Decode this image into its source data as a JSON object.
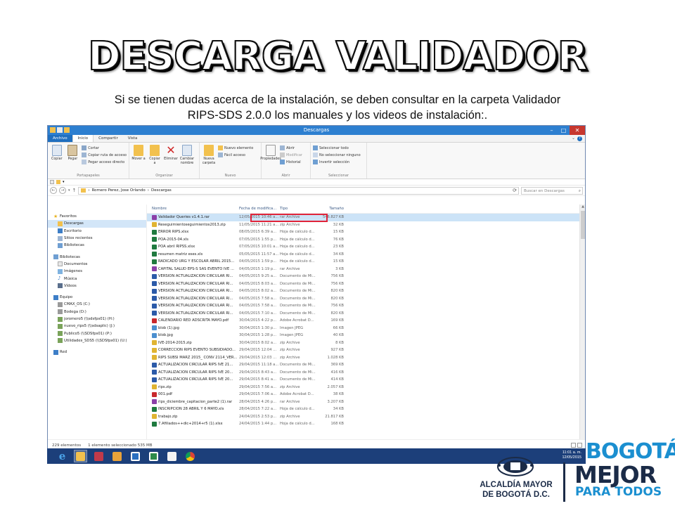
{
  "slide": {
    "title": "DESCARGA VALIDADOR",
    "subtitle_line1": "Si se tienen dudas acerca de la instalación, se deben consultar en  la carpeta Validador",
    "subtitle_line2": "RIPS-SDS 2.0.0 los manuales y los videos de instalación:."
  },
  "window": {
    "title": "Descargas",
    "tabs": [
      "Archivo",
      "Inicio",
      "Compartir",
      "Vista"
    ],
    "ribbon": {
      "portapapeles": {
        "label": "Portapapeles",
        "copiar": "Copiar",
        "pegar": "Pegar",
        "cortar": "Cortar",
        "copiar_ruta": "Copiar ruta de acceso",
        "pegar_acceso": "Pegar acceso directo"
      },
      "organizar": {
        "label": "Organizar",
        "mover": "Mover a",
        "copiar_a": "Copiar a",
        "eliminar": "Eliminar",
        "cambiar_nombre": "Cambiar nombre"
      },
      "nuevo": {
        "label": "Nuevo",
        "nueva_carpeta": "Nueva carpeta",
        "nuevo_elemento": "Nuevo elemento",
        "facil_acceso": "Fácil acceso"
      },
      "abrir": {
        "label": "Abrir",
        "propiedades": "Propiedades",
        "abrir": "Abrir",
        "modificar": "Modificar",
        "historial": "Historial"
      },
      "seleccionar": {
        "label": "Seleccionar",
        "todo": "Seleccionar todo",
        "ninguno": "No seleccionar ninguno",
        "invertir": "Invertir selección"
      }
    },
    "address": {
      "crumb1": "Romero Perez, Jose Orlando",
      "crumb2": "Descargas",
      "search_placeholder": "Buscar en Descargas"
    },
    "nav": {
      "favoritos": "Favoritos",
      "fav_items": [
        "Descargas",
        "Escritorio",
        "Sitios recientes",
        "Bibliotecas"
      ],
      "bibliotecas": "Bibliotecas",
      "lib_items": [
        "Documentos",
        "Imágenes",
        "Música",
        "Vídeos"
      ],
      "equipo": "Equipo",
      "equipo_items": [
        "CMAX_OS (C:)",
        "Bodega (D:)",
        "joromero5 (\\\\sdsfps01) (H:)",
        "nuevo_rips5 (\\\\sdsaplic) (J:)",
        "Publico5 (\\\\SDSfps01) (P:)",
        "Utilidades_SDS5 (\\\\SDSfps01) (U:)"
      ],
      "red": "Red"
    },
    "columns": {
      "name": "Nombre",
      "date": "Fecha de modifica...",
      "type": "Tipo",
      "size": "Tamaño"
    },
    "files": [
      {
        "name": "Validador Queries v1.4.1.rar",
        "date": "12/05/2015 10:46 a...",
        "type": "rar Archive",
        "size": "546.827 KB",
        "icon": "rar-icon",
        "selected": true
      },
      {
        "name": "Reseguimientoseguimientos2013.zip",
        "date": "11/05/2015 11:21 a...",
        "type": "zip Archive",
        "size": "32 KB",
        "icon": "zip-icon"
      },
      {
        "name": "ERROR RIPS.xlsx",
        "date": "08/05/2015 6:39 a...",
        "type": "Hoja de cálculo d...",
        "size": "15 KB",
        "icon": "excel-icon"
      },
      {
        "name": "POA-2015-04.xls",
        "date": "07/05/2015 1:55 p...",
        "type": "Hoja de cálculo d...",
        "size": "76 KB",
        "icon": "excel-icon"
      },
      {
        "name": "POA abril RIPSS.xlsx",
        "date": "07/05/2015 10:01 a...",
        "type": "Hoja de cálculo d...",
        "size": "23 KB",
        "icon": "excel-icon"
      },
      {
        "name": "resumen matriz eses.xls",
        "date": "05/05/2015 11:57 a...",
        "type": "Hoja de cálculo d...",
        "size": "34 KB",
        "icon": "excel-icon"
      },
      {
        "name": "RADICADO URG Y ESCOLAR  ABRIL 2015...",
        "date": "04/05/2015 1:59 p...",
        "type": "Hoja de cálculo d...",
        "size": "15 KB",
        "icon": "excel-icon"
      },
      {
        "name": "CAPITAL SALUD EPS-S SAS EVENTO IVE ...",
        "date": "04/05/2015 1:19 p...",
        "type": "rar Archive",
        "size": "3 KB",
        "icon": "rar-icon"
      },
      {
        "name": "VERSION ACTUALIZACION CIRCULAR RI...",
        "date": "04/05/2015 9:25 a...",
        "type": "Documento de Mi...",
        "size": "756 KB",
        "icon": "word-icon"
      },
      {
        "name": "VERSION ACTUALIZACION CIRCULAR RI...",
        "date": "04/05/2015 8:03 a...",
        "type": "Documento de Mi...",
        "size": "756 KB",
        "icon": "word-icon"
      },
      {
        "name": "VERSION ACTUALIZACION CIRCULAR RI...",
        "date": "04/05/2015 8:02 a...",
        "type": "Documento de Mi...",
        "size": "820 KB",
        "icon": "word-icon"
      },
      {
        "name": "VERSION ACTUALIZACION CIRCULAR RI...",
        "date": "04/05/2015 7:58 a...",
        "type": "Documento de Mi...",
        "size": "820 KB",
        "icon": "word-icon"
      },
      {
        "name": "VERSION ACTUALIZACION CIRCULAR RI...",
        "date": "04/05/2015 7:58 a...",
        "type": "Documento de Mi...",
        "size": "756 KB",
        "icon": "word-icon"
      },
      {
        "name": "VERSION ACTUALIZACION CIRCULAR RI...",
        "date": "04/05/2015 7:10 a...",
        "type": "Documento de Mi...",
        "size": "820 KB",
        "icon": "word-icon"
      },
      {
        "name": "CALENDARIO RED ADSCRITA MAYO.pdf",
        "date": "30/04/2015 4:22 p...",
        "type": "Adobe Acrobat D...",
        "size": "169 KB",
        "icon": "pdf-icon"
      },
      {
        "name": "blob (1).jpg",
        "date": "30/04/2015 1:30 p...",
        "type": "Imagen JPEG",
        "size": "66 KB",
        "icon": "image-icon"
      },
      {
        "name": "blob.jpg",
        "date": "30/04/2015 1:28 p...",
        "type": "Imagen JPEG",
        "size": "40 KB",
        "icon": "image-icon"
      },
      {
        "name": "IVE-2014-2015.zip",
        "date": "30/04/2015 8:02 a...",
        "type": "zip Archive",
        "size": "8 KB",
        "icon": "zip-icon"
      },
      {
        "name": "CORRECCION RIPS EVENTO SUBSIDIADO...",
        "date": "29/04/2015 12:04 ...",
        "type": "zip Archive",
        "size": "927 KB",
        "icon": "zip-icon"
      },
      {
        "name": "RIPS SUBSI MARZ 2015_ CONV 2114_VER...",
        "date": "29/04/2015 12:03 ...",
        "type": "zip Archive",
        "size": "1.028 KB",
        "icon": "zip-icon"
      },
      {
        "name": "ACTUALIZACION CIRCULAR RIPS IVE  21...",
        "date": "29/04/2015 11:18 a...",
        "type": "Documento de Mi...",
        "size": "369 KB",
        "icon": "word-icon"
      },
      {
        "name": "ACTUALIZACION CIRCULAR RIPS IVE  20...",
        "date": "29/04/2015 8:43 a...",
        "type": "Documento de Mi...",
        "size": "416 KB",
        "icon": "word-icon"
      },
      {
        "name": "ACTUALIZACION CIRCULAR RIPS IVE  20...",
        "date": "29/04/2015 8:41 a...",
        "type": "Documento de Mi...",
        "size": "414 KB",
        "icon": "word-icon"
      },
      {
        "name": "rips.zip",
        "date": "29/04/2015 7:56 a...",
        "type": "zip Archive",
        "size": "2.057 KB",
        "icon": "zip-icon"
      },
      {
        "name": "001.pdf",
        "date": "29/04/2015 7:06 a...",
        "type": "Adobe Acrobat D...",
        "size": "38 KB",
        "icon": "pdf-icon"
      },
      {
        "name": "rips_diciembre_capitacion_parte2 (1).rar",
        "date": "28/04/2015 4:26 p...",
        "type": "rar Archive",
        "size": "3.207 KB",
        "icon": "rar-icon"
      },
      {
        "name": "INSCRIPCION 28 ABRIL Y 6 MAYO.xls",
        "date": "28/04/2015 7:22 a...",
        "type": "Hoja de cálculo d...",
        "size": "34 KB",
        "icon": "excel-icon"
      },
      {
        "name": "trabajo.zip",
        "date": "24/04/2015 2:53 p...",
        "type": "zip Archive",
        "size": "21.817 KB",
        "icon": "zip-icon"
      },
      {
        "name": "7.Afiliados++dic+2014+r5 (1).xlsx",
        "date": "24/04/2015 1:44 p...",
        "type": "Hoja de cálculo d...",
        "size": "168 KB",
        "icon": "excel-icon"
      }
    ],
    "status": {
      "count": "229 elementos",
      "selection": "1 elemento seleccionado  535 MB"
    }
  },
  "taskbar": {
    "time": "11:01 a. m.",
    "date": "12/05/2015",
    "apps": [
      "internet-explorer-icon",
      "file-explorer-icon",
      "tools-icon",
      "folder-icon",
      "outlook-icon",
      "excel-icon",
      "checklist-icon",
      "chrome-icon"
    ]
  },
  "logos": {
    "alcaldia_line1": "ALCALDÍA MAYOR",
    "alcaldia_line2": "DE BOGOTÁ D.C.",
    "bogota": "BOGOTÁ",
    "mejor": "MEJOR",
    "para_todos": "PARA TODOS"
  },
  "colors": {
    "titlebar": "#2d7fd0",
    "highlight_box": "#e0243a",
    "taskbar": "#1c3f7a",
    "logo_navy": "#1b2b47",
    "logo_blue": "#1b8fd0"
  }
}
